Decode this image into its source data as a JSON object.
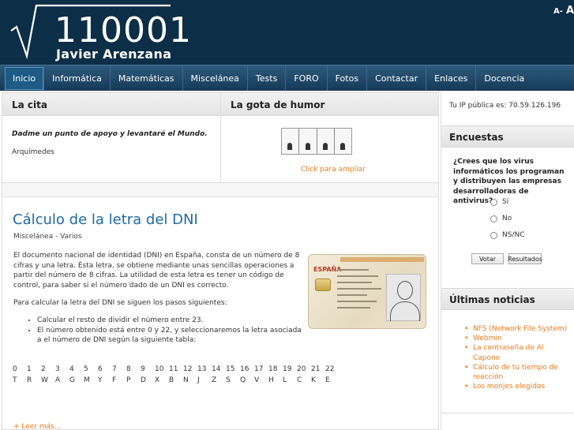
{
  "header": {
    "logo_number": "110001",
    "logo_name": "Javier Arenzana",
    "font_decrease": "A-",
    "font_increase": "A"
  },
  "nav": {
    "items": [
      "Inicio",
      "Informática",
      "Matemáticas",
      "Miscelánea",
      "Tests",
      "FORO",
      "Fotos",
      "Contactar",
      "Enlaces",
      "Docencia"
    ],
    "active": "Inicio"
  },
  "cita": {
    "title": "La cita",
    "quote": "Dadme un punto de apoyo y levantaré el Mundo.",
    "author": "Arquímedes"
  },
  "humor": {
    "title": "La gota de humor",
    "link": "Click para ampliar"
  },
  "article": {
    "title": "Cálculo de la letra del DNI",
    "category": "Miscelánea - Varios",
    "para1": "El documento nacional de identidad (DNI) en España, consta de un número de 8 cifras y una letra. Ésta letra, se obtiene mediante unas sencillas operaciones a partir del número de 8 cifras. La utilidad de esta letra es tener un código de control, para saber si el número dado de un DNI es correcto.",
    "para2": "Para calcular la letra del DNI se siguen los pasos siguientes:",
    "steps": [
      "Calcular el resto de dividir el número entre 23.",
      "El número obtenido está entre 0 y 22, y seleccionaremos la letra asociada a el número de DNI según la siguiente tabla:"
    ],
    "card_label": "ESPAÑA",
    "numbers": [
      "0",
      "1",
      "2",
      "3",
      "4",
      "5",
      "6",
      "7",
      "8",
      "9",
      "10",
      "11",
      "12",
      "13",
      "14",
      "15",
      "16",
      "17",
      "18",
      "19",
      "20",
      "21",
      "22"
    ],
    "letters": [
      "T",
      "R",
      "W",
      "A",
      "G",
      "M",
      "Y",
      "F",
      "P",
      "D",
      "X",
      "B",
      "N",
      "J",
      "Z",
      "S",
      "Q",
      "V",
      "H",
      "L",
      "C",
      "K",
      "E"
    ],
    "read_more": "Leer más..."
  },
  "sidebar": {
    "ip_text": "Tu IP pública es: 70.59.126.196",
    "encuestas_title": "Encuestas",
    "poll_question": "¿Crees que los virus informáticos los programan y distribuyen las empresas desarrolladoras de antivirus?",
    "poll_options": [
      "Sí",
      "No",
      "NS/NC"
    ],
    "vote_label": "Votar",
    "results_label": "Resultados",
    "noticias_title": "Últimas noticias",
    "news": [
      "NFS (Network File System)",
      "Webmin",
      "La contraseña de Al Capone",
      "Cálculo de tu tiempo de reacción",
      "Los monjes elegidos"
    ]
  },
  "colors": {
    "header_bg": "#0d2e47",
    "link": "#e87a1c",
    "article_title": "#1d6aa6"
  }
}
